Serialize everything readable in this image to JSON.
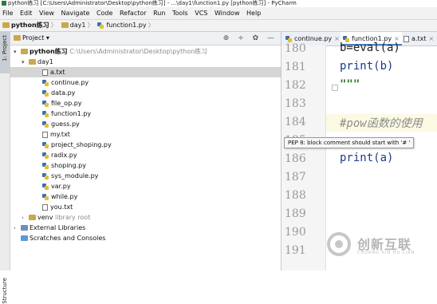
{
  "window": {
    "title": "python练习 [C:\\Users\\Administrator\\Desktop\\python练习] - ...\\day1\\function1.py [python练习] - PyCharm"
  },
  "menu": [
    "File",
    "Edit",
    "View",
    "Navigate",
    "Code",
    "Refactor",
    "Run",
    "Tools",
    "VCS",
    "Window",
    "Help"
  ],
  "breadcrumb": [
    "python练习",
    "day1",
    "function1.py"
  ],
  "project_panel": {
    "title": "Project",
    "tools": "⊕ ÷ ✿ —",
    "side_tab": "1: Project",
    "side_tab2": "Structure",
    "root_name": "python练习",
    "root_path": "C:\\Users\\Administrator\\Desktop\\python练习",
    "folder": "day1",
    "files": [
      "a.txt",
      "continue.py",
      "data.py",
      "file_op.py",
      "function1.py",
      "guess.py",
      "my.txt",
      "project_shoping.py",
      "radix.py",
      "shoping.py",
      "sys_module.py",
      "var.py",
      "while.py",
      "you.txt"
    ],
    "venv": "venv",
    "venv_note": "library root",
    "external": "External Libraries",
    "scratches": "Scratches and Consoles"
  },
  "editor": {
    "tabs": [
      "continue.py",
      "function1.py",
      "a.txt"
    ],
    "active_tab": "function1.py",
    "line_numbers": [
      "180",
      "181",
      "182",
      "183",
      "184",
      "185",
      "186",
      "187",
      "188",
      "189",
      "190",
      "191"
    ],
    "code": {
      "l180": "b=eval(a)",
      "l181": "print(b)",
      "l182": "\"\"\"",
      "l184": "#pow函数的使用",
      "l186": "print(a)"
    },
    "tooltip": "PEP 8: block comment should start with '# '"
  },
  "watermark": {
    "cn": "创新互联",
    "en": "CHUANG XIN HU LIAN"
  }
}
